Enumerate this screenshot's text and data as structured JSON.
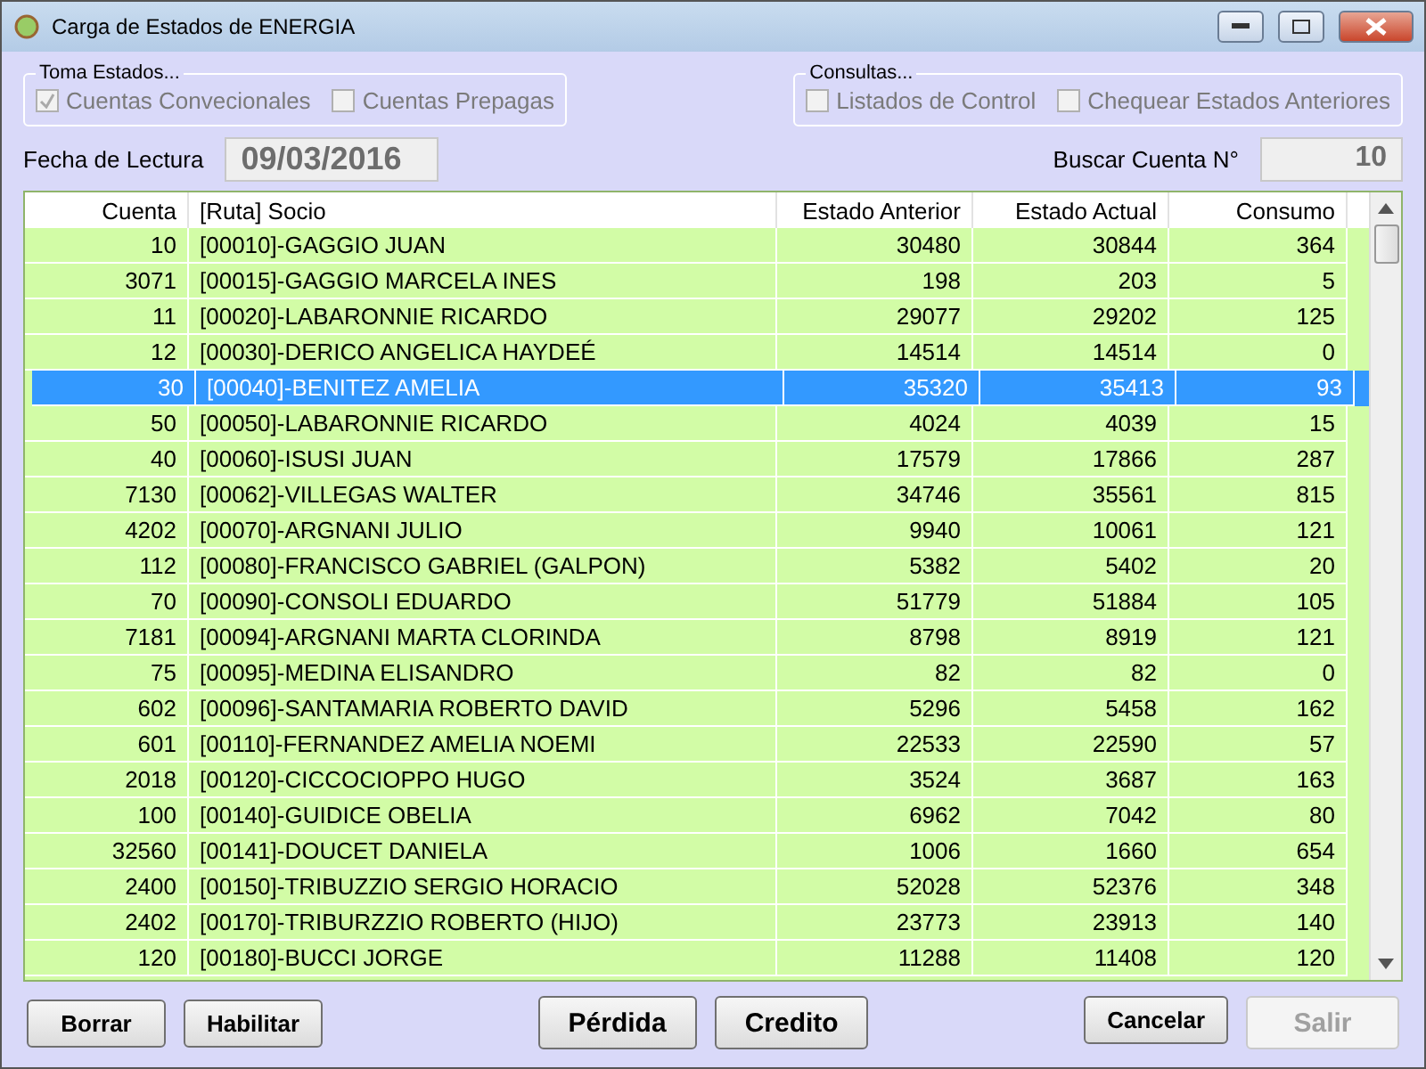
{
  "window": {
    "title": "Carga de Estados de ENERGIA"
  },
  "groups": [
    {
      "title": "Toma Estados...",
      "options": [
        {
          "label": "Cuentas Convecionales",
          "checked": true
        },
        {
          "label": "Cuentas Prepagas",
          "checked": false
        }
      ]
    },
    {
      "title": "Consultas...",
      "options": [
        {
          "label": "Listados de Control",
          "checked": false
        },
        {
          "label": "Chequear Estados Anteriores",
          "checked": false
        }
      ]
    }
  ],
  "fecha": {
    "label": "Fecha de Lectura",
    "value": "09/03/2016"
  },
  "buscar": {
    "label": "Buscar Cuenta N°",
    "value": "10"
  },
  "table": {
    "columns": [
      "Cuenta",
      "[Ruta] Socio",
      "Estado Anterior",
      "Estado Actual",
      "Consumo"
    ],
    "rows": [
      {
        "cells": [
          "10",
          "[00010]-GAGGIO JUAN",
          "30480",
          "30844",
          "364"
        ],
        "selected": false
      },
      {
        "cells": [
          "3071",
          "[00015]-GAGGIO MARCELA INES",
          "198",
          "203",
          "5"
        ],
        "selected": false
      },
      {
        "cells": [
          "11",
          "[00020]-LABARONNIE RICARDO",
          "29077",
          "29202",
          "125"
        ],
        "selected": false
      },
      {
        "cells": [
          "12",
          "[00030]-DERICO ANGELICA HAYDEÉ",
          "14514",
          "14514",
          "0"
        ],
        "selected": false
      },
      {
        "cells": [
          "30",
          "[00040]-BENITEZ AMELIA",
          "35320",
          "35413",
          "93"
        ],
        "selected": true
      },
      {
        "cells": [
          "50",
          "[00050]-LABARONNIE RICARDO",
          "4024",
          "4039",
          "15"
        ],
        "selected": false
      },
      {
        "cells": [
          "40",
          "[00060]-ISUSI JUAN",
          "17579",
          "17866",
          "287"
        ],
        "selected": false
      },
      {
        "cells": [
          "7130",
          "[00062]-VILLEGAS WALTER",
          "34746",
          "35561",
          "815"
        ],
        "selected": false
      },
      {
        "cells": [
          "4202",
          "[00070]-ARGNANI JULIO",
          "9940",
          "10061",
          "121"
        ],
        "selected": false
      },
      {
        "cells": [
          "112",
          "[00080]-FRANCISCO GABRIEL (GALPON)",
          "5382",
          "5402",
          "20"
        ],
        "selected": false
      },
      {
        "cells": [
          "70",
          "[00090]-CONSOLI EDUARDO",
          "51779",
          "51884",
          "105"
        ],
        "selected": false
      },
      {
        "cells": [
          "7181",
          "[00094]-ARGNANI MARTA CLORINDA",
          "8798",
          "8919",
          "121"
        ],
        "selected": false
      },
      {
        "cells": [
          "75",
          "[00095]-MEDINA ELISANDRO",
          "82",
          "82",
          "0"
        ],
        "selected": false
      },
      {
        "cells": [
          "602",
          "[00096]-SANTAMARIA ROBERTO DAVID",
          "5296",
          "5458",
          "162"
        ],
        "selected": false
      },
      {
        "cells": [
          "601",
          "[00110]-FERNANDEZ AMELIA NOEMI",
          "22533",
          "22590",
          "57"
        ],
        "selected": false
      },
      {
        "cells": [
          "2018",
          "[00120]-CICCOCIOPPO HUGO",
          "3524",
          "3687",
          "163"
        ],
        "selected": false
      },
      {
        "cells": [
          "100",
          "[00140]-GUIDICE OBELIA",
          "6962",
          "7042",
          "80"
        ],
        "selected": false
      },
      {
        "cells": [
          "32560",
          "[00141]-DOUCET DANIELA",
          "1006",
          "1660",
          "654"
        ],
        "selected": false
      },
      {
        "cells": [
          "2400",
          "[00150]-TRIBUZZIO SERGIO HORACIO",
          "52028",
          "52376",
          "348"
        ],
        "selected": false
      },
      {
        "cells": [
          "2402",
          "[00170]-TRIBURZZIO ROBERTO (HIJO)",
          "23773",
          "23913",
          "140"
        ],
        "selected": false
      },
      {
        "cells": [
          "120",
          "[00180]-BUCCI JORGE",
          "11288",
          "11408",
          "120"
        ],
        "selected": false
      }
    ]
  },
  "buttons": [
    {
      "label": "Borrar",
      "disabled": false
    },
    {
      "label": "Habilitar",
      "disabled": false
    },
    {
      "label": "Pérdida",
      "disabled": false
    },
    {
      "label": "Credito",
      "disabled": false
    },
    {
      "label": "Cancelar",
      "disabled": false
    },
    {
      "label": "Salir",
      "disabled": true
    }
  ]
}
